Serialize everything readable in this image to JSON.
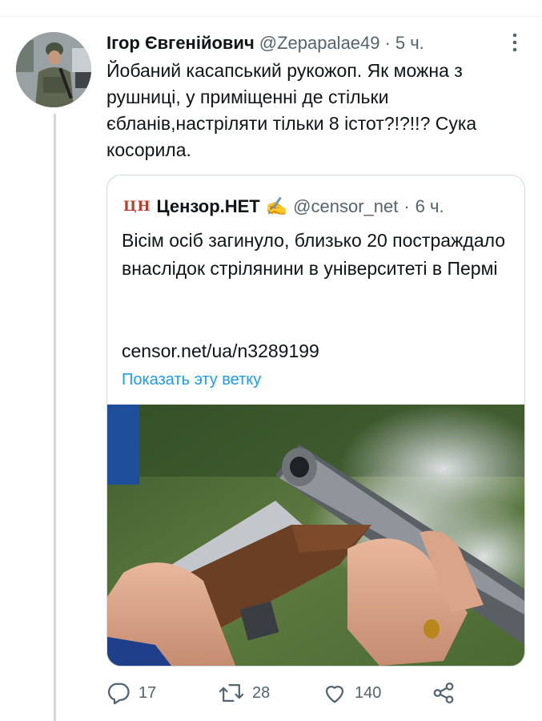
{
  "tweet": {
    "author_name": "Ігор Євгенійович",
    "handle": "@Zepapalae49",
    "separator": "·",
    "time": "5 ч.",
    "text": "Йобаний касапський рукожоп. Як можна з рушниці, у приміщенні де стільки єбланів,настріляти тільки 8 істот?!?!!? Сука косорила."
  },
  "quote": {
    "logo_text": "ЦН",
    "author_name": "Цензор.НЕТ",
    "verified_emoji": "✍️",
    "handle": "@censor_net",
    "separator": "·",
    "time": "6 ч.",
    "text": "Вісім осіб загинуло, близько 20 постраждало внаслідок стрілянини в університеті в Пермі",
    "link": "censor.net/ua/n3289199",
    "show_thread": "Показать эту ветку"
  },
  "actions": {
    "replies": "17",
    "retweets": "28",
    "likes": "140"
  },
  "icons": {
    "more": "more-vertical-icon",
    "reply": "reply-icon",
    "retweet": "retweet-icon",
    "like": "heart-icon",
    "share": "share-icon"
  },
  "colors": {
    "link_blue": "#1d9bf0",
    "muted_gray": "#536471",
    "border": "#cfd9de",
    "text": "#0f1419"
  }
}
